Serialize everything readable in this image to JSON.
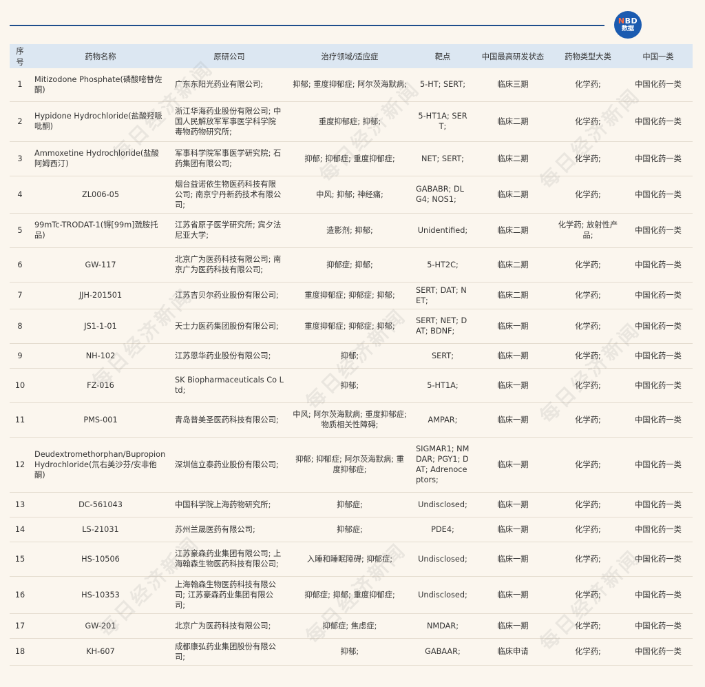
{
  "logo": {
    "line1_n": "N",
    "line1_rest": "BD",
    "line2": "数据"
  },
  "watermark": "每日经济新闻",
  "headers": [
    "序号",
    "药物名称",
    "原研公司",
    "治疗领域/适应症",
    "靶点",
    "中国最高研发状态",
    "药物类型大类",
    "中国一类"
  ],
  "rows": [
    [
      "1",
      "Mitizodone Phosphate(磷酸嘧替佐酮)",
      "广东东阳光药业有限公司;",
      "抑郁; 重度抑郁症; 阿尔茨海默病;",
      "5-HT; SERT;",
      "临床三期",
      "化学药;",
      "中国化药一类"
    ],
    [
      "2",
      "Hypidone Hydrochloride(盐酸羟哌吡酮)",
      "浙江华海药业股份有限公司; 中国人民解放军军事医学科学院毒物药物研究所;",
      "重度抑郁症; 抑郁;",
      "5-HT1A; SERT;",
      "临床二期",
      "化学药;",
      "中国化药一类"
    ],
    [
      "3",
      "Ammoxetine Hydrochloride(盐酸阿姆西汀)",
      "军事科学院军事医学研究院; 石药集团有限公司;",
      "抑郁; 抑郁症; 重度抑郁症;",
      "NET; SERT;",
      "临床二期",
      "化学药;",
      "中国化药一类"
    ],
    [
      "4",
      "ZL006-05",
      "烟台益诺依生物医药科技有限公司; 南京宁丹新药技术有限公司;",
      "中风; 抑郁; 神经痛;",
      "GABABR; DLG4; NOS1;",
      "临床二期",
      "化学药;",
      "中国化药一类"
    ],
    [
      "5",
      "99mTc-TRODAT-1(锝[99m]巯胺托品)",
      "江苏省原子医学研究所; 宾夕法尼亚大学;",
      "造影剂; 抑郁;",
      "Unidentified;",
      "临床二期",
      "化学药; 放射性产品;",
      "中国化药一类"
    ],
    [
      "6",
      "GW-117",
      "北京广为医药科技有限公司; 南京广为医药科技有限公司;",
      "抑郁症; 抑郁;",
      "5-HT2C;",
      "临床二期",
      "化学药;",
      "中国化药一类"
    ],
    [
      "7",
      "JJH-201501",
      "江苏吉贝尔药业股份有限公司;",
      "重度抑郁症; 抑郁症; 抑郁;",
      "SERT; DAT; NET;",
      "临床二期",
      "化学药;",
      "中国化药一类"
    ],
    [
      "8",
      "JS1-1-01",
      "天士力医药集团股份有限公司;",
      "重度抑郁症; 抑郁症; 抑郁;",
      "SERT; NET; DAT; BDNF;",
      "临床一期",
      "化学药;",
      "中国化药一类"
    ],
    [
      "9",
      "NH-102",
      "江苏恩华药业股份有限公司;",
      "抑郁;",
      "SERT;",
      "临床一期",
      "化学药;",
      "中国化药一类"
    ],
    [
      "10",
      "FZ-016",
      "SK Biopharmaceuticals Co Ltd;",
      "抑郁;",
      "5-HT1A;",
      "临床一期",
      "化学药;",
      "中国化药一类"
    ],
    [
      "11",
      "PMS-001",
      "青岛普美圣医药科技有限公司;",
      "中风; 阿尔茨海默病; 重度抑郁症; 物质相关性障碍;",
      "AMPAR;",
      "临床一期",
      "化学药;",
      "中国化药一类"
    ],
    [
      "12",
      "Deudextromethorphan/Bupropion Hydrochloride(氘右美沙芬/安非他酮)",
      "深圳信立泰药业股份有限公司;",
      "抑郁; 抑郁症; 阿尔茨海默病; 重度抑郁症;",
      "SIGMAR1; NMDAR; PGY1; DAT; Adrenoceptors;",
      "临床一期",
      "化学药;",
      "中国化药一类"
    ],
    [
      "13",
      "DC-561043",
      "中国科学院上海药物研究所;",
      "抑郁症;",
      "Undisclosed;",
      "临床一期",
      "化学药;",
      "中国化药一类"
    ],
    [
      "14",
      "LS-21031",
      "苏州兰晟医药有限公司;",
      "抑郁症;",
      "PDE4;",
      "临床一期",
      "化学药;",
      "中国化药一类"
    ],
    [
      "15",
      "HS-10506",
      "江苏豪森药业集团有限公司; 上海翰森生物医药科技有限公司;",
      "入睡和睡眠障碍; 抑郁症;",
      "Undisclosed;",
      "临床一期",
      "化学药;",
      "中国化药一类"
    ],
    [
      "16",
      "HS-10353",
      "上海翰森生物医药科技有限公司; 江苏豪森药业集团有限公司;",
      "抑郁症; 抑郁; 重度抑郁症;",
      "Undisclosed;",
      "临床一期",
      "化学药;",
      "中国化药一类"
    ],
    [
      "17",
      "GW-201",
      "北京广为医药科技有限公司;",
      "抑郁症; 焦虑症;",
      "NMDAR;",
      "临床一期",
      "化学药;",
      "中国化药一类"
    ],
    [
      "18",
      "KH-607",
      "成都康弘药业集团股份有限公司;",
      "抑郁;",
      "GABAAR;",
      "临床申请",
      "化学药;",
      "中国化药一类"
    ]
  ]
}
